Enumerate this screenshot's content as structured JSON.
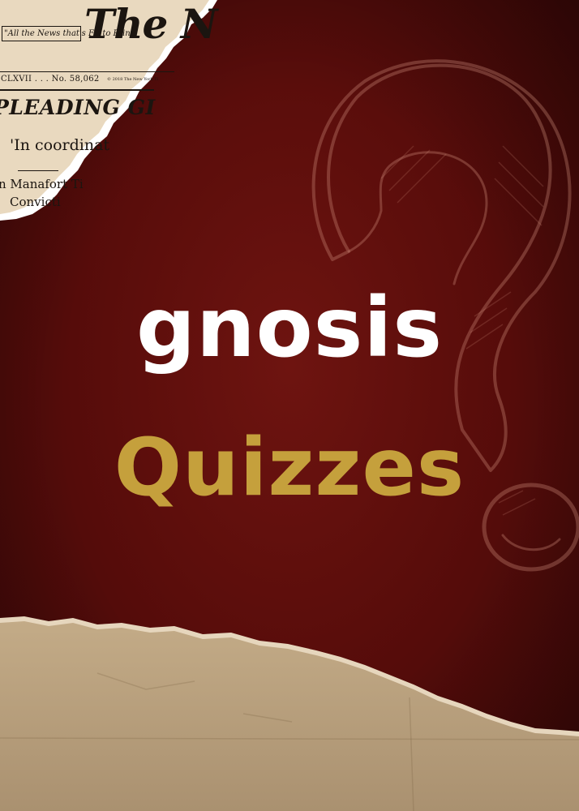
{
  "poster": {
    "title_line1": "gnosis",
    "title_line2": "Quizzes",
    "colors": {
      "background": "#5a0d0b",
      "title_line1": "#ffffff",
      "title_line2": "#c5a03c",
      "paper": "#e8d8bd",
      "kraft": "#b79f7c"
    }
  },
  "newspaper": {
    "slogan": "\"All the News that's Fit to Print\"",
    "masthead": "The N",
    "issue": "..CLXVII . . . No. 58,062",
    "copyright": "© 2018 The New York Ti",
    "headline": "PLEADING GI",
    "subhead": "'In coordinat",
    "story_line1": "n Manafort Ti",
    "story_line2": "Convicti"
  },
  "decor": {
    "question_mark": "question-mark-icon"
  }
}
